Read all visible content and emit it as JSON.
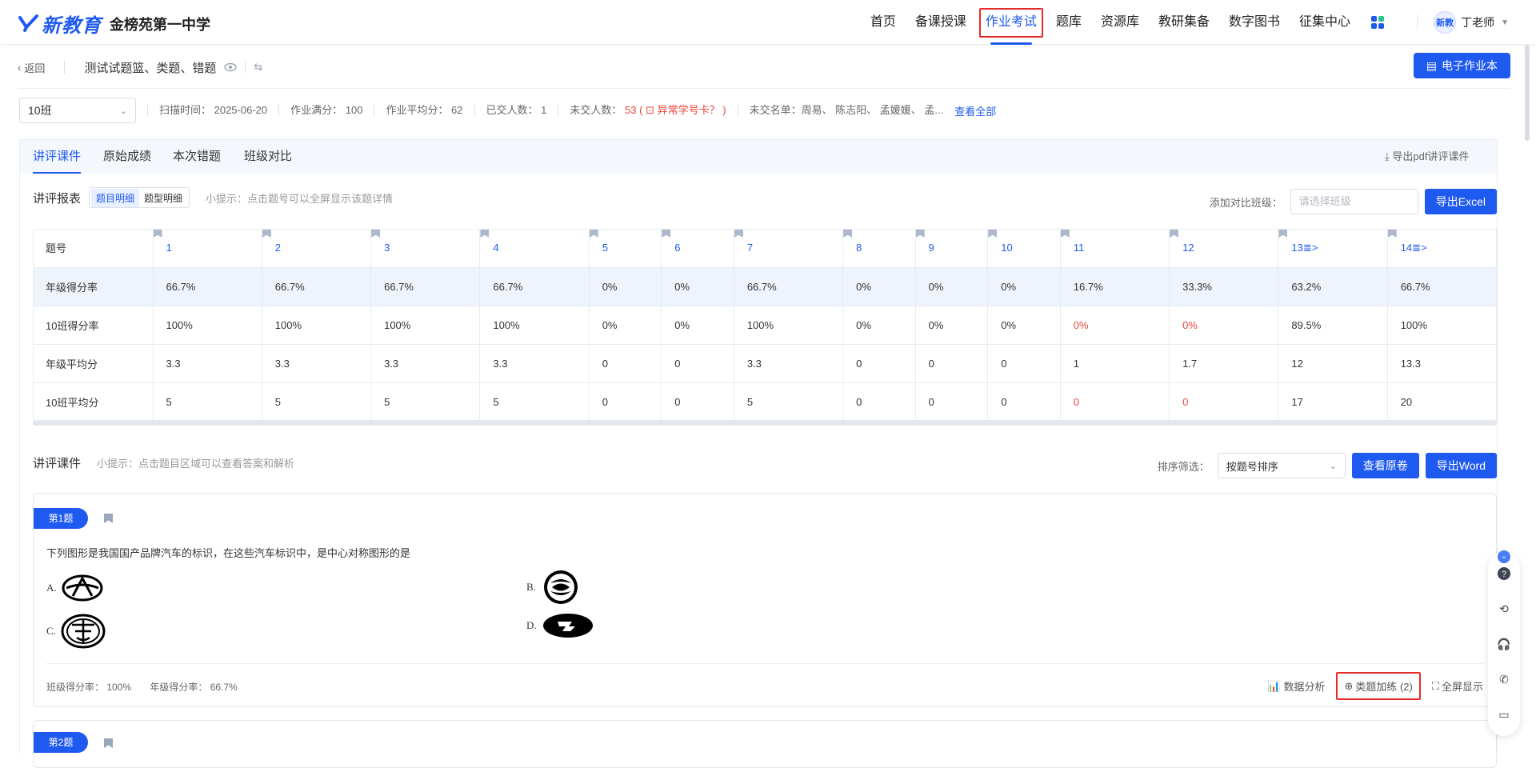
{
  "header": {
    "logo_text": "新教育",
    "school": "金榜苑第一中学",
    "nav": [
      "首页",
      "备课授课",
      "作业考试",
      "题库",
      "资源库",
      "教研集备",
      "数字图书",
      "征集中心"
    ],
    "active_nav": "作业考试",
    "user": {
      "avatar_text": "新教",
      "name": "丁老师"
    }
  },
  "subbar": {
    "back": "返回",
    "title": "测试试题篮、类题、错题",
    "ebook_button": "电子作业本"
  },
  "info": {
    "class": "10班",
    "scan_time": "扫描时间： 2025-06-20",
    "full_score": "作业满分： 100",
    "avg_score": "作业平均分： 62",
    "submitted": "已交人数： 1",
    "not_submitted_label": "未交人数：",
    "not_submitted_count": "53",
    "abnormal": "异常学号卡？",
    "not_submitted_list": "未交名单：周易、 陈志阳、 孟媛媛、 孟...",
    "view_all": "查看全部"
  },
  "tabs": [
    "讲评课件",
    "原始成绩",
    "本次错题",
    "班级对比"
  ],
  "export_pdf": "导出pdf讲评课件",
  "report": {
    "title": "讲评报表",
    "toggle": [
      "题目明细",
      "题型明细"
    ],
    "hint": "小提示：点击题号可以全屏显示该题详情",
    "compare_label": "添加对比班级：",
    "compare_placeholder": "请选择班级",
    "export_excel": "导出Excel",
    "columns": [
      "题号",
      "1",
      "2",
      "3",
      "4",
      "5",
      "6",
      "7",
      "8",
      "9",
      "10",
      "11",
      "12",
      "13≣>",
      "14≣>"
    ],
    "rows": [
      {
        "label": "年级得分率",
        "values": [
          "66.7%",
          "66.7%",
          "66.7%",
          "66.7%",
          "0%",
          "0%",
          "66.7%",
          "0%",
          "0%",
          "0%",
          "16.7%",
          "33.3%",
          "63.2%",
          "66.7%"
        ]
      },
      {
        "label": "10班得分率",
        "values": [
          "100%",
          "100%",
          "100%",
          "100%",
          "0%",
          "0%",
          "100%",
          "0%",
          "0%",
          "0%",
          "0%",
          "0%",
          "89.5%",
          "100%"
        ]
      },
      {
        "label": "年级平均分",
        "values": [
          "3.3",
          "3.3",
          "3.3",
          "3.3",
          "0",
          "0",
          "3.3",
          "0",
          "0",
          "0",
          "1",
          "1.7",
          "12",
          "13.3"
        ]
      },
      {
        "label": "10班平均分",
        "values": [
          "5",
          "5",
          "5",
          "5",
          "0",
          "0",
          "5",
          "0",
          "0",
          "0",
          "0",
          "0",
          "17",
          "20"
        ]
      }
    ]
  },
  "lecture": {
    "title": "讲评课件",
    "hint": "小提示：点击题目区域可以查看答案和解析",
    "sort_label": "排序筛选：",
    "sort_value": "按题号排序",
    "view_original": "查看原卷",
    "export_word": "导出Word"
  },
  "question1": {
    "badge": "第1题",
    "text": "下列图形是我国国产品牌汽车的标识，在这些汽车标识中，是中心对称图形的是",
    "options": [
      "A.",
      "B.",
      "C.",
      "D."
    ],
    "class_rate": "班级得分率： 100%",
    "grade_rate": "年级得分率： 66.7%",
    "actions": {
      "data_analysis": "数据分析",
      "similar_practice": "类题加练 (2)",
      "fullscreen": "全屏显示"
    }
  },
  "question2": {
    "badge": "第2题"
  }
}
